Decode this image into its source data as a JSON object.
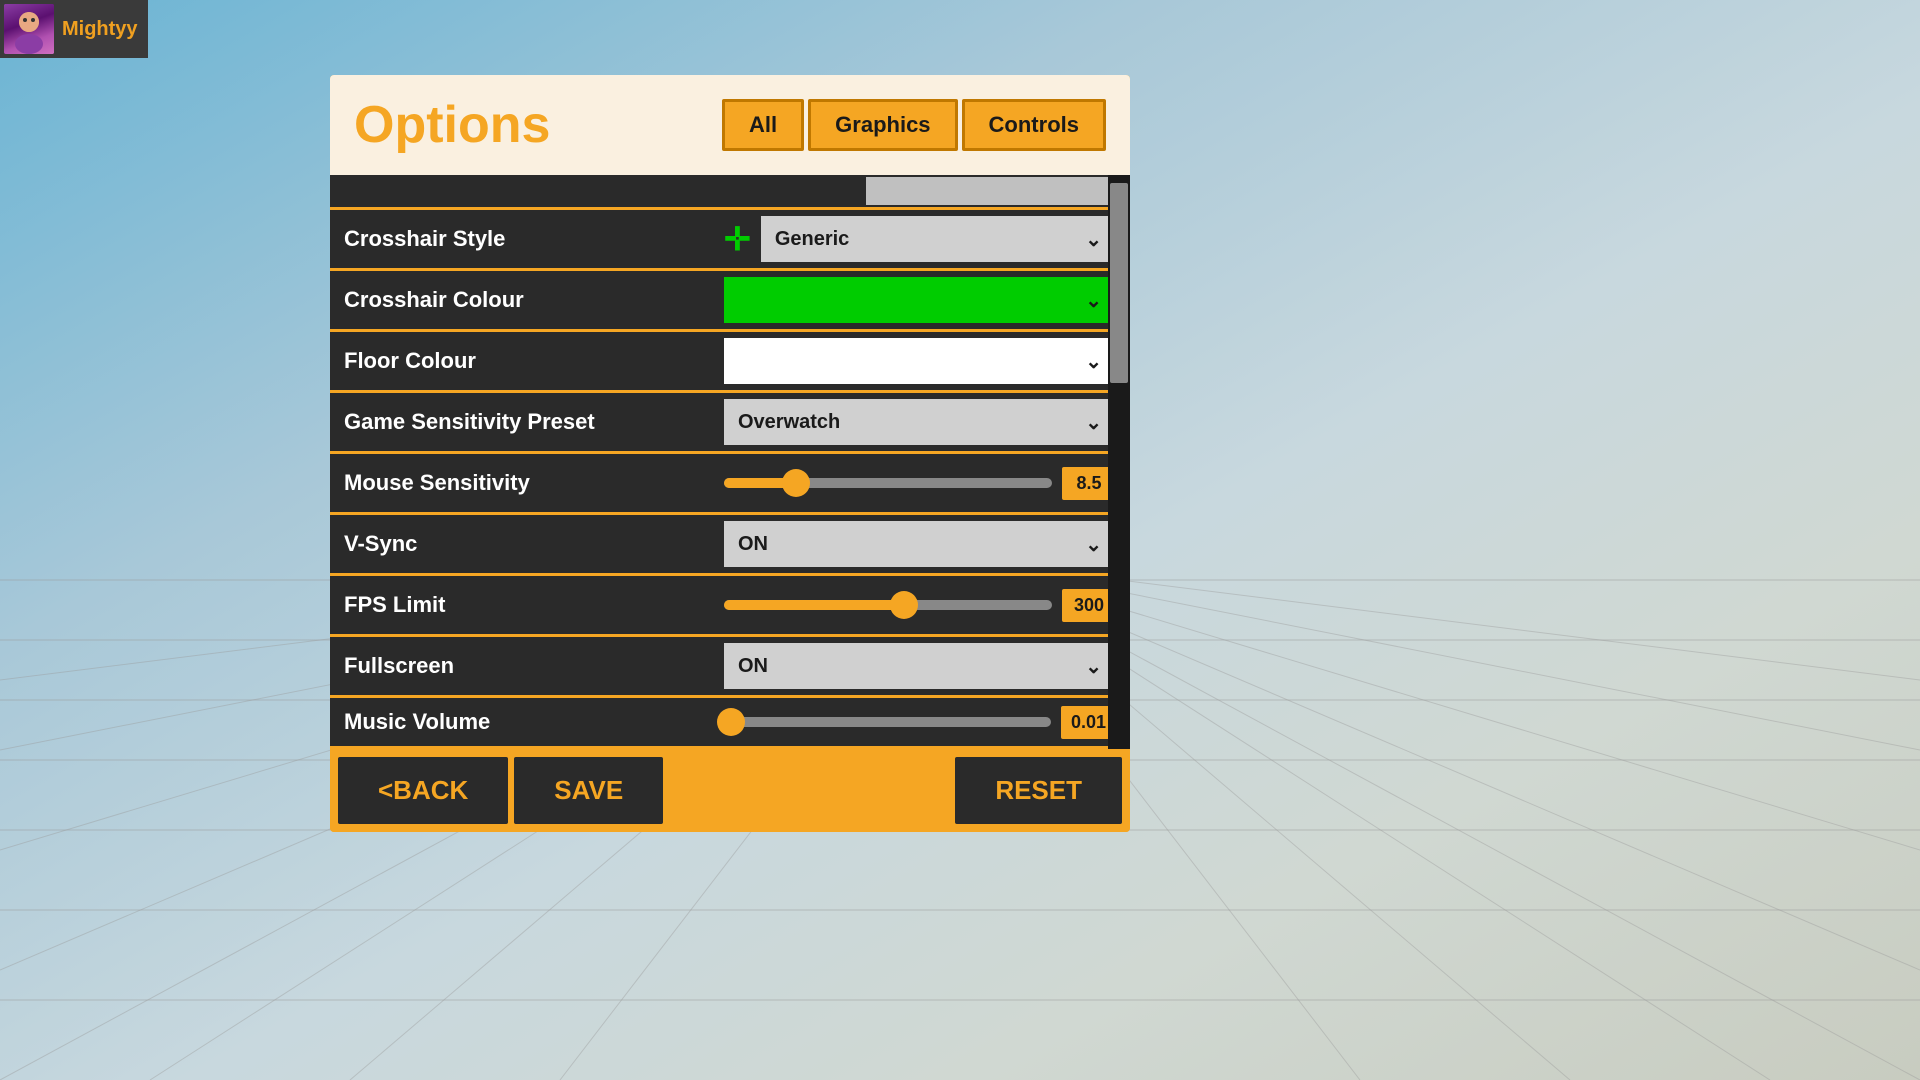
{
  "background": {
    "gradient_start": "#6ab4d4",
    "gradient_end": "#c8ccc0"
  },
  "user": {
    "name": "Mightyy"
  },
  "panel": {
    "title": "Options",
    "tabs": [
      {
        "id": "all",
        "label": "All",
        "active": true
      },
      {
        "id": "graphics",
        "label": "Graphics",
        "active": false
      },
      {
        "id": "controls",
        "label": "Controls",
        "active": false
      }
    ]
  },
  "settings": {
    "partial_row": {
      "label": "",
      "value": ""
    },
    "crosshair_style": {
      "label": "Crosshair Style",
      "value": "Generic"
    },
    "crosshair_colour": {
      "label": "Crosshair Colour",
      "value": ""
    },
    "floor_colour": {
      "label": "Floor Colour",
      "value": ""
    },
    "game_sensitivity_preset": {
      "label": "Game Sensitivity Preset",
      "value": "Overwatch"
    },
    "mouse_sensitivity": {
      "label": "Mouse Sensitivity",
      "value": "8.5",
      "slider_pct": 22
    },
    "vsync": {
      "label": "V-Sync",
      "value": "ON"
    },
    "fps_limit": {
      "label": "FPS Limit",
      "value": "300",
      "slider_pct": 55
    },
    "fullscreen": {
      "label": "Fullscreen",
      "value": "ON"
    },
    "music_volume": {
      "label": "Music Volume",
      "value": "0.01",
      "slider_pct": 2
    }
  },
  "footer": {
    "back_label": "<BACK",
    "save_label": "SAVE",
    "reset_label": "RESET"
  }
}
